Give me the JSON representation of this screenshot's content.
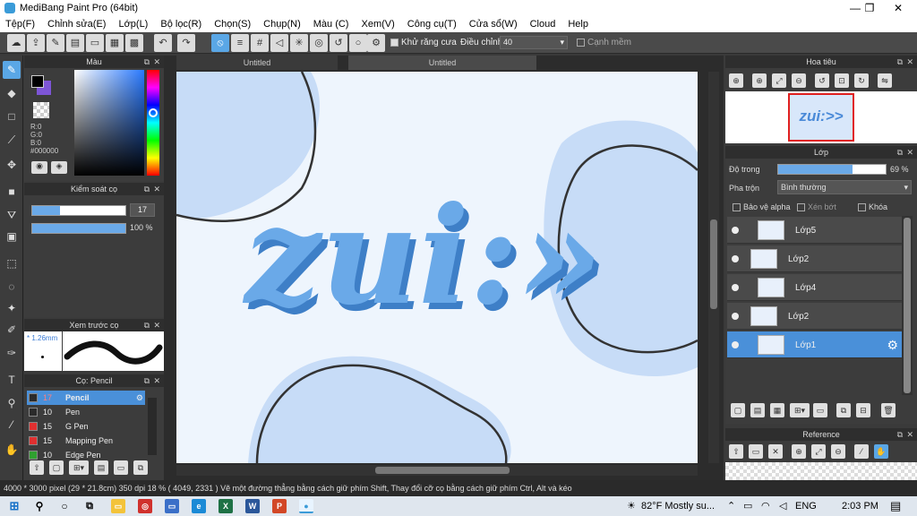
{
  "window": {
    "title": "MediBang Paint Pro (64bit)",
    "min": "—",
    "max": "❐",
    "close": "✕"
  },
  "menu": [
    "Tệp(F)",
    "Chỉnh sửa(E)",
    "Lớp(L)",
    "Bộ lọc(R)",
    "Chọn(S)",
    "Chụp(N)",
    "Màu (C)",
    "Xem(V)",
    "Công cụ(T)",
    "Cửa sổ(W)",
    "Cloud",
    "Help"
  ],
  "toolbar": {
    "antialias_label": "Khử răng cưa",
    "correction_label": "Điều chỉnh",
    "correction_value": "40",
    "soft_edge_label": "Cạnh mềm"
  },
  "color_panel": {
    "title": "Màu",
    "r": "R:0",
    "g": "G:0",
    "b": "B:0",
    "hex": "#000000",
    "fg": "#000000",
    "bg": "#7d55d6"
  },
  "brush_control": {
    "title": "Kiểm soát cọ",
    "size": "17",
    "opacity": "100 %",
    "size_fraction": 0.3,
    "opacity_fraction": 1.0
  },
  "brush_preview": {
    "title": "Xem trước cọ",
    "size_label": "1.26mm"
  },
  "brush_list": {
    "title": "Cọ: Pencil",
    "items": [
      {
        "size": "17",
        "name": "Pencil",
        "color": "#2b2b2b",
        "selected": true
      },
      {
        "size": "10",
        "name": "Pen",
        "color": "#2b2b2b",
        "selected": false
      },
      {
        "size": "15",
        "name": "G Pen",
        "color": "#e03030",
        "selected": false
      },
      {
        "size": "15",
        "name": "Mapping Pen",
        "color": "#e03030",
        "selected": false
      },
      {
        "size": "10",
        "name": "Edge Pen",
        "color": "#30a030",
        "selected": false
      }
    ]
  },
  "canvas": {
    "tabs": [
      "Untitled",
      "Untitled"
    ],
    "artwork_text": "zui:>>"
  },
  "navigator": {
    "title": "Hoa tiêu"
  },
  "layers_panel": {
    "title": "Lớp",
    "opacity_label": "Độ trong",
    "opacity_value": "69 %",
    "opacity_fraction": 0.69,
    "blend_label": "Pha trộn",
    "blend_value": "Bình thường",
    "protect_alpha": "Bảo vệ alpha",
    "clipping": "Xén bớt",
    "lock": "Khóa",
    "layers": [
      {
        "name": "Lớp5",
        "selected": false
      },
      {
        "name": "Lớp2",
        "selected": false
      },
      {
        "name": "Lớp4",
        "selected": false
      },
      {
        "name": "Lớp2",
        "selected": false
      },
      {
        "name": "Lớp1",
        "selected": true
      }
    ]
  },
  "reference": {
    "title": "Reference"
  },
  "status": {
    "text": "4000 * 3000 pixel   (29 * 21.8cm)   350 dpi   18 %   ( 4049, 2331 )   Vẽ một đường thẳng bằng cách giữ phím Shift, Thay đổi cỡ cọ bằng cách giữ phím Ctrl, Alt và kéo"
  },
  "taskbar": {
    "weather": "82°F  Mostly su...",
    "lang": "ENG",
    "time": "2:03 PM"
  },
  "colors": {
    "accent": "#5aa7e6",
    "selected_layer": "#4a90d9",
    "art_blue": "#6aa9e8"
  }
}
